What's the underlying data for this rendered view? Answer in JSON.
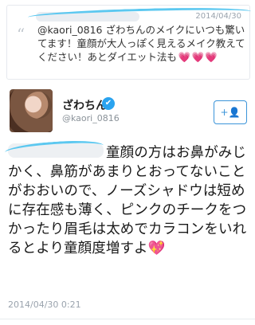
{
  "reply": {
    "date": "2014/04/30",
    "quote_mark": "“",
    "text": "@kaori_0816 ざわちんのメイクにいつも驚いてます！童顔が大人っぽく見えるメイク教えてください！あとダイエット法も",
    "hearts": "💗💗💗"
  },
  "author": {
    "name": "ざわちん",
    "verified_glyph": "✔",
    "handle": "@kaori_0816",
    "follow_label": "+👤"
  },
  "tweet": {
    "text": "童顔の方はお鼻がみじかく、鼻筋があまりとおってないことがおおいので、ノーズシャドウは短めに存在感も薄く、ピンクのチークをつかったり眉毛は太めでカラコンをいれるとより童顔度増すよ",
    "emoji": "💖",
    "timestamp": "2014/04/30 0:21"
  },
  "colors": {
    "accent": "#3b94d9",
    "verified": "#2aa3ef",
    "redact_marker": "#5cc8f0"
  }
}
